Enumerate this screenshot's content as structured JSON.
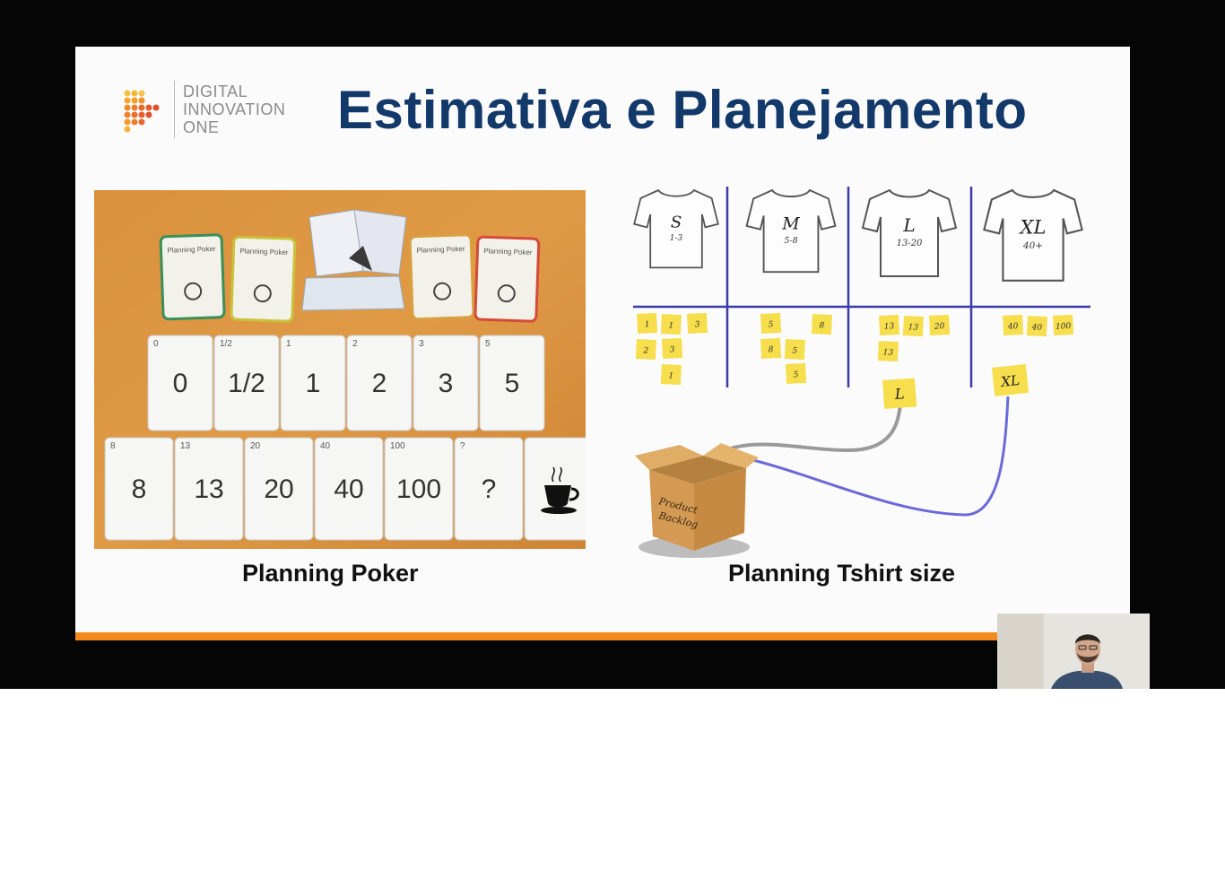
{
  "slide": {
    "logo": {
      "line1": "DIGITAL",
      "line2": "INNOVATION",
      "line3": "ONE"
    },
    "title": "Estimativa e Planejamento",
    "left_caption": "Planning Poker",
    "right_caption": "Planning Tshirt size",
    "accent_color": "#f28a1e",
    "title_color": "#13396b"
  },
  "poker_photo": {
    "header_cards": [
      "Planning Poker",
      "Planning Poker",
      "Planning Poker",
      "Planning Poker"
    ],
    "row1": [
      "0",
      "1/2",
      "1",
      "2",
      "3",
      "5"
    ],
    "row2": [
      "8",
      "13",
      "20",
      "40",
      "100",
      "?"
    ],
    "last_card_icon": "coffee-cup-icon"
  },
  "tshirt_diagram": {
    "sizes": [
      {
        "label": "S",
        "range": "1-3"
      },
      {
        "label": "M",
        "range": "5-8"
      },
      {
        "label": "L",
        "range": "13-20"
      },
      {
        "label": "XL",
        "range": "40+"
      }
    ],
    "notes": [
      [
        "1",
        "1",
        "3",
        "2",
        "3",
        "1"
      ],
      [
        "5",
        "8",
        "8",
        "5",
        "5"
      ],
      [
        "13",
        "13",
        "20",
        "13"
      ],
      [
        "40",
        "40",
        "100"
      ]
    ],
    "selected_l": "L",
    "selected_xl": "XL",
    "box_label_line1": "Product",
    "box_label_line2": "Backlog"
  }
}
